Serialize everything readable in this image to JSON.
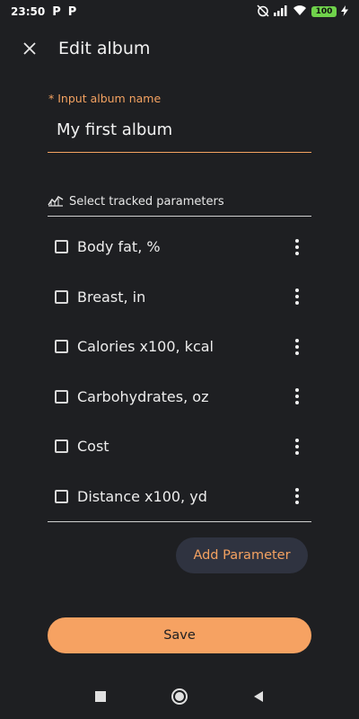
{
  "status_bar": {
    "time": "23:50",
    "notification_icons": [
      "P",
      "P"
    ],
    "battery_level": "100"
  },
  "header": {
    "title": "Edit album",
    "close_icon": "close-icon"
  },
  "album_name": {
    "label": "* Input album name",
    "value": "My first album"
  },
  "tracked_params": {
    "header_label": "Select tracked parameters",
    "header_icon": "chart-line-icon",
    "items": [
      {
        "label": "Body fat, %",
        "checked": false
      },
      {
        "label": "Breast, in",
        "checked": false
      },
      {
        "label": "Calories x100, kcal",
        "checked": false
      },
      {
        "label": "Carbohydrates, oz",
        "checked": false
      },
      {
        "label": "Cost",
        "checked": false
      },
      {
        "label": "Distance x100, yd",
        "checked": false
      }
    ]
  },
  "actions": {
    "add_parameter_label": "Add Parameter",
    "save_label": "Save"
  },
  "colors": {
    "background": "#1e1f22",
    "accent": "#f6a262",
    "secondary_button": "#2f3340"
  }
}
